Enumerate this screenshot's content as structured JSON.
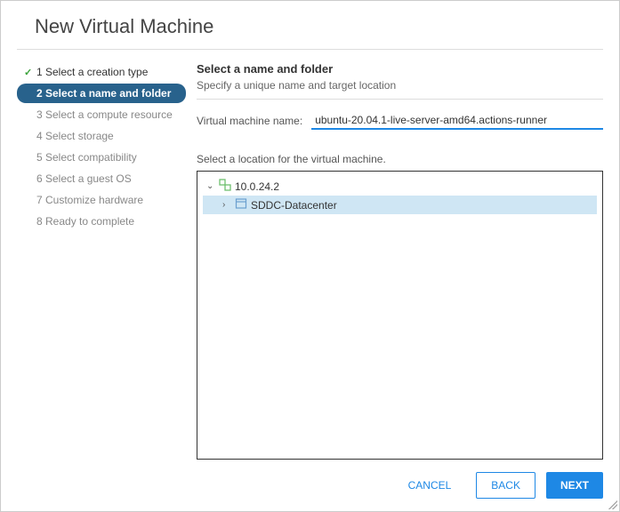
{
  "dialog": {
    "title": "New Virtual Machine"
  },
  "steps": [
    {
      "label": "1 Select a creation type",
      "state": "done"
    },
    {
      "label": "2 Select a name and folder",
      "state": "active"
    },
    {
      "label": "3 Select a compute resource",
      "state": "pending"
    },
    {
      "label": "4 Select storage",
      "state": "pending"
    },
    {
      "label": "5 Select compatibility",
      "state": "pending"
    },
    {
      "label": "6 Select a guest OS",
      "state": "pending"
    },
    {
      "label": "7 Customize hardware",
      "state": "pending"
    },
    {
      "label": "8 Ready to complete",
      "state": "pending"
    }
  ],
  "panel": {
    "title": "Select a name and folder",
    "subtitle": "Specify a unique name and target location",
    "name_label": "Virtual machine name:",
    "name_value": "ubuntu-20.04.1-live-server-amd64.actions-runner",
    "location_label": "Select a location for the virtual machine."
  },
  "tree": {
    "root": {
      "label": "10.0.24.2"
    },
    "child": {
      "label": "SDDC-Datacenter"
    }
  },
  "footer": {
    "cancel": "CANCEL",
    "back": "BACK",
    "next": "NEXT"
  }
}
